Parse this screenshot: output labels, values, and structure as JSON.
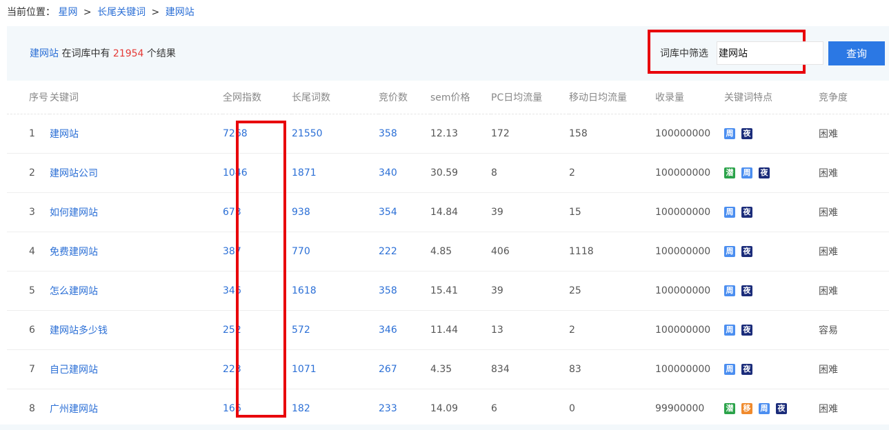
{
  "breadcrumb": {
    "prefix": "当前位置：",
    "items": [
      "星网",
      "长尾关键词",
      "建网站"
    ],
    "separator": ">"
  },
  "summary": {
    "keyword": "建网站",
    "mid": " 在词库中有 ",
    "count": "21954",
    "suffix": " 个结果"
  },
  "filter": {
    "label": "词库中筛选",
    "value": "建网站",
    "button": "查询"
  },
  "table": {
    "headers": [
      "序号",
      "关键词",
      "全网指数",
      "长尾词数",
      "竞价数",
      "sem价格",
      "PC日均流量",
      "移动日均流量",
      "收录量",
      "关键词特点",
      "竞争度"
    ],
    "rows": [
      {
        "no": "1",
        "keyword": "建网站",
        "index": "7268",
        "longtail": "21550",
        "bids": "358",
        "sem": "12.13",
        "pc": "172",
        "mobile": "158",
        "indexed": "100000000",
        "tags": [
          "周",
          "夜"
        ],
        "competition": "困难"
      },
      {
        "no": "2",
        "keyword": "建网站公司",
        "index": "1046",
        "longtail": "1871",
        "bids": "340",
        "sem": "30.59",
        "pc": "8",
        "mobile": "2",
        "indexed": "100000000",
        "tags": [
          "潜",
          "周",
          "夜"
        ],
        "competition": "困难"
      },
      {
        "no": "3",
        "keyword": "如何建网站",
        "index": "673",
        "longtail": "938",
        "bids": "354",
        "sem": "14.84",
        "pc": "39",
        "mobile": "15",
        "indexed": "100000000",
        "tags": [
          "周",
          "夜"
        ],
        "competition": "困难"
      },
      {
        "no": "4",
        "keyword": "免费建网站",
        "index": "387",
        "longtail": "770",
        "bids": "222",
        "sem": "4.85",
        "pc": "406",
        "mobile": "1118",
        "indexed": "100000000",
        "tags": [
          "周",
          "夜"
        ],
        "competition": "困难"
      },
      {
        "no": "5",
        "keyword": "怎么建网站",
        "index": "346",
        "longtail": "1618",
        "bids": "358",
        "sem": "15.41",
        "pc": "39",
        "mobile": "25",
        "indexed": "100000000",
        "tags": [
          "周",
          "夜"
        ],
        "competition": "困难"
      },
      {
        "no": "6",
        "keyword": "建网站多少钱",
        "index": "252",
        "longtail": "572",
        "bids": "346",
        "sem": "11.44",
        "pc": "13",
        "mobile": "2",
        "indexed": "100000000",
        "tags": [
          "周",
          "夜"
        ],
        "competition": "容易"
      },
      {
        "no": "7",
        "keyword": "自己建网站",
        "index": "223",
        "longtail": "1071",
        "bids": "267",
        "sem": "4.35",
        "pc": "834",
        "mobile": "83",
        "indexed": "100000000",
        "tags": [
          "周",
          "夜"
        ],
        "competition": "困难"
      },
      {
        "no": "8",
        "keyword": "广州建网站",
        "index": "166",
        "longtail": "182",
        "bids": "233",
        "sem": "14.09",
        "pc": "6",
        "mobile": "0",
        "indexed": "99900000",
        "tags": [
          "潜",
          "移",
          "周",
          "夜"
        ],
        "competition": "困难"
      }
    ]
  },
  "colors": {
    "link": "#2b6fd6",
    "count": "#e53935",
    "highlight_border": "#e8000b",
    "button": "#2b78e4",
    "tag_zhou": "#4b8ef0",
    "tag_ye": "#1b2c7a",
    "tag_qian": "#2ba34a",
    "tag_yi": "#f08a2c"
  }
}
